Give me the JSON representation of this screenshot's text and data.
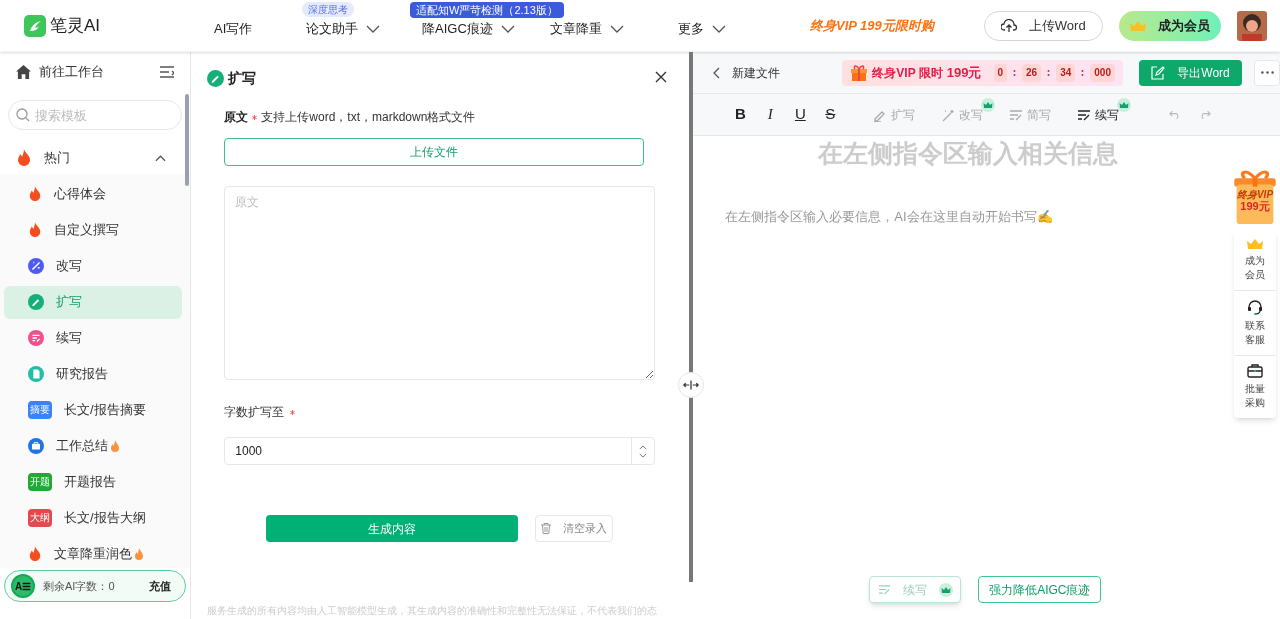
{
  "brand": {
    "name": "笔灵AI"
  },
  "nav": [
    {
      "label": "AI写作",
      "dropdown": false
    },
    {
      "label": "论文助手",
      "dropdown": true,
      "tag": "深度思考"
    },
    {
      "label": "降AIGC痕迹",
      "dropdown": true,
      "tag": "适配知W严苛检测（2.13版）"
    },
    {
      "label": "文章降重",
      "dropdown": true
    },
    {
      "label": "更多",
      "dropdown": true
    }
  ],
  "promo": "终身VIP 199元限时购",
  "upload_word": "上传Word",
  "become_member": "成为会员",
  "sidebar": {
    "workbench": "前往工作台",
    "search_placeholder": "搜索模板",
    "group": {
      "label": "热门",
      "expanded": true,
      "items": [
        {
          "label": "心得体会",
          "kind": "fire",
          "hot": false,
          "selected": false
        },
        {
          "label": "自定义撰写",
          "kind": "fire",
          "hot": false,
          "selected": false
        },
        {
          "label": "改写",
          "kind": "wand",
          "hot": false,
          "selected": false
        },
        {
          "label": "扩写",
          "kind": "pen",
          "hot": false,
          "selected": true
        },
        {
          "label": "续写",
          "kind": "lines",
          "hot": false,
          "selected": false
        },
        {
          "label": "研究报告",
          "kind": "doc",
          "hot": false,
          "selected": false
        },
        {
          "label": "长文/报告摘要",
          "kind": "tag",
          "tag": "摘要",
          "color": "#3b82f6",
          "hot": false,
          "selected": false
        },
        {
          "label": "工作总结",
          "kind": "case",
          "hot": true,
          "selected": false
        },
        {
          "label": "开题报告",
          "kind": "tag",
          "tag": "开题",
          "color": "#22a833",
          "hot": false,
          "selected": false
        },
        {
          "label": "长文/报告大纲",
          "kind": "tag",
          "tag": "大纲",
          "color": "#e5484d",
          "hot": false,
          "selected": false
        },
        {
          "label": "文章降重润色",
          "kind": "fire",
          "hot": true,
          "selected": false
        }
      ]
    },
    "quota": {
      "avatar": "A☰",
      "label": "剩余AI字数：0",
      "action": "充值"
    }
  },
  "form": {
    "title": "扩写",
    "source_label": "原文",
    "source_hint": "支持上传word，txt，markdown格式文件",
    "upload_button": "上传文件",
    "source_placeholder": "原文",
    "words_label": "字数扩写至",
    "words_value": "1000",
    "generate": "生成内容",
    "clear": "清空录入",
    "disclaimer": "服务生成的所有内容均由人工智能模型生成，其生成内容的准确性和完整性无法保证，不代表我们的态"
  },
  "editor": {
    "file_name": "新建文件",
    "vip_banner": {
      "label": "终身VIP 限时",
      "price": "199元",
      "countdown": [
        "0",
        "26",
        "34",
        "000"
      ]
    },
    "export": "导出Word",
    "format": [
      {
        "label": "B",
        "kind": "bold"
      },
      {
        "label": "I",
        "kind": "italic"
      },
      {
        "label": "U",
        "kind": "underline"
      },
      {
        "label": "S",
        "kind": "strike"
      }
    ],
    "tools": [
      {
        "label": "扩写",
        "disabled": true,
        "premium": false,
        "kind": "pen"
      },
      {
        "label": "改写",
        "disabled": true,
        "premium": true,
        "kind": "wand"
      },
      {
        "label": "简写",
        "disabled": true,
        "premium": false,
        "kind": "lines"
      },
      {
        "label": "续写",
        "disabled": false,
        "premium": true,
        "kind": "lines"
      }
    ],
    "heading": "在左侧指令区输入相关信息",
    "body": "在左侧指令区输入必要信息，AI会在这里自动开始书写✍️",
    "continue_button": {
      "label": "续写",
      "disabled": true
    },
    "reduce_button": "强力降低AIGC痕迹"
  },
  "float": {
    "vip_line1": "终身VIP",
    "vip_line2": "199元",
    "items": [
      {
        "label": "成为会员",
        "kind": "crown"
      },
      {
        "label": "联系客服",
        "kind": "headset"
      },
      {
        "label": "批量采购",
        "kind": "briefcase"
      }
    ]
  }
}
